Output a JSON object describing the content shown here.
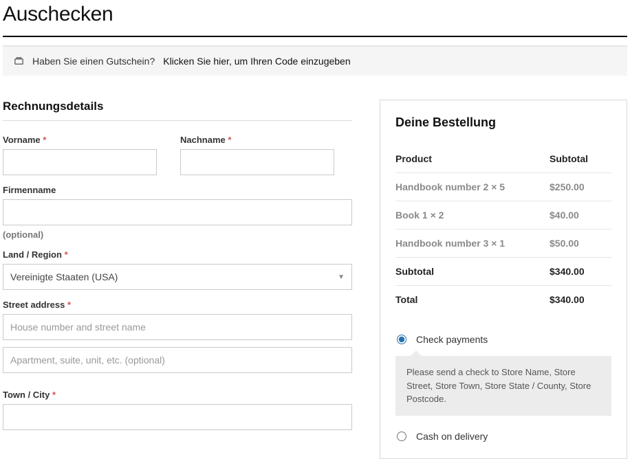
{
  "page_title": "Auschecken",
  "coupon": {
    "prompt": "Haben Sie einen Gutschein?",
    "link": "Klicken Sie hier, um Ihren Code einzugeben"
  },
  "billing": {
    "heading": "Rechnungsdetails",
    "first_name_label": "Vorname",
    "last_name_label": "Nachname",
    "company_label": "Firmenname",
    "company_optional": "(optional)",
    "country_label": "Land / Region",
    "country_value": "Vereinigte Staaten (USA)",
    "street_label": "Street address",
    "street_placeholder1": "House number and street name",
    "street_placeholder2": "Apartment, suite, unit, etc. (optional)",
    "city_label": "Town / City",
    "required_mark": "*"
  },
  "order": {
    "heading": "Deine Bestellung",
    "col_product": "Product",
    "col_subtotal": "Subtotal",
    "items": [
      {
        "name": "Handbook number 2",
        "qty": "× 5",
        "price": "$250.00"
      },
      {
        "name": "Book 1",
        "qty": "× 2",
        "price": "$40.00"
      },
      {
        "name": "Handbook number 3",
        "qty": "× 1",
        "price": "$50.00"
      }
    ],
    "subtotal_label": "Subtotal",
    "subtotal_value": "$340.00",
    "total_label": "Total",
    "total_value": "$340.00"
  },
  "payment": {
    "check_label": "Check payments",
    "check_desc": "Please send a check to Store Name, Store Street, Store Town, Store State / County, Store Postcode.",
    "cod_label": "Cash on delivery"
  }
}
